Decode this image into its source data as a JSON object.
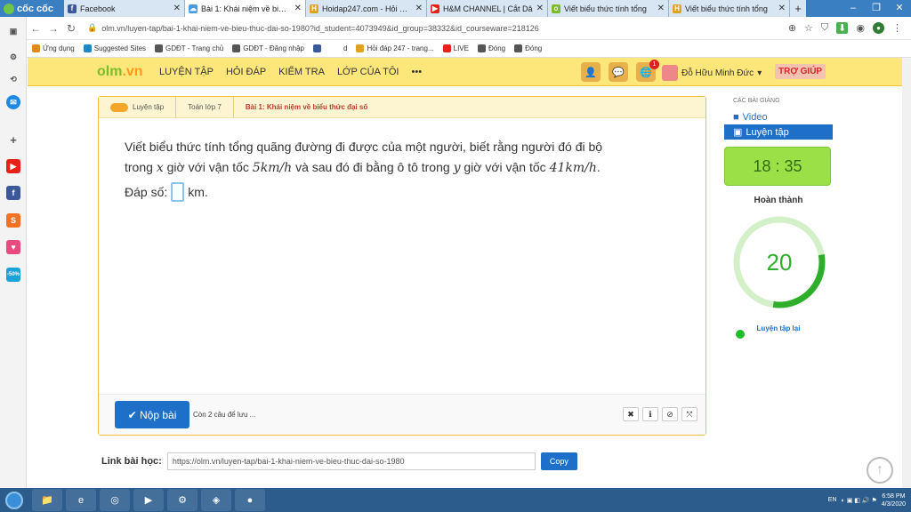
{
  "browser": {
    "brand": "cốc cốc",
    "tabs": [
      {
        "label": "Facebook",
        "icon": "facebook-icon",
        "color": "#3b5998",
        "glyph": "f"
      },
      {
        "label": "Bài 1: Khái niệm về biểu t",
        "icon": "cloud-icon",
        "color": "#4a9be0",
        "glyph": "☁",
        "active": true
      },
      {
        "label": "Hoidap247.com - Hỏi đáp",
        "icon": "hoidap-icon",
        "color": "#e0a020",
        "glyph": "H"
      },
      {
        "label": "H&M CHANNEL | Cắt Dâ",
        "icon": "youtube-icon",
        "color": "#e62117",
        "glyph": "▶"
      },
      {
        "label": "Viết biểu thức tính tổng",
        "icon": "olm-icon",
        "color": "#7cbb2a",
        "glyph": "o"
      },
      {
        "label": "Viết biểu thức tính tổng",
        "icon": "hoidap-icon",
        "color": "#e0a020",
        "glyph": "H"
      }
    ],
    "url": "olm.vn/luyen-tap/bai-1-khai-niem-ve-bieu-thuc-dai-so-1980?id_student=4073949&id_group=38332&id_courseware=218126",
    "bookmarks": [
      {
        "label": "Ứng dụng",
        "color": "#e08a1e"
      },
      {
        "label": "Suggested Sites",
        "color": "#1e88c7"
      },
      {
        "label": "GDĐT - Trang chủ",
        "color": "#555555"
      },
      {
        "label": "GDĐT - Đăng nhập",
        "color": "#555555"
      },
      {
        "label": "",
        "color": "#3b5998"
      },
      {
        "label": "d",
        "color": "#ffffff"
      },
      {
        "label": "Hỏi đáp 247 - trang...",
        "color": "#e0a020"
      },
      {
        "label": "LIVE",
        "color": "#e62117"
      },
      {
        "label": "Đóng",
        "color": "#555555"
      },
      {
        "label": "Đóng",
        "color": "#555555"
      }
    ]
  },
  "olm": {
    "logo_a": "olm",
    "logo_b": ".vn",
    "nav": [
      "LUYỆN TẬP",
      "HỎI ĐÁP",
      "KIỂM TRA",
      "LỚP CỦA TÔI",
      "•••"
    ],
    "notif_count": "1",
    "user_name": "Đỗ Hữu Minh Đức",
    "help": "TRỢ GIÚP"
  },
  "breadcrumb": [
    "Luyện tập",
    "Toán lớp 7",
    "Bài 1: Khái niệm về biểu thức đại số"
  ],
  "question": {
    "line1": "Viết biểu thức tính tổng quãng đường đi được của một người, biết rằng người đó đi bộ",
    "p1": "trong ",
    "var_x": "x",
    "p2": " giờ với vận tốc ",
    "speed1": "5km/h",
    "p3": " và sau đó đi bằng ô tô trong ",
    "var_y": "y",
    "p4": " giờ với vận tốc ",
    "speed2": "41km/h",
    "p5": ".",
    "answer_label": "Đáp số:",
    "unit": "km."
  },
  "footer": {
    "submit": "✔ Nộp bài",
    "remain": "Còn 2 câu để lưu ..."
  },
  "link": {
    "label": "Link bài học:",
    "value": "https://olm.vn/luyen-tap/bai-1-khai-niem-ve-bieu-thuc-dai-so-1980",
    "copy": "Copy"
  },
  "sidebar": {
    "header": "CÁC BÀI GIẢNG",
    "items": [
      {
        "label": "Video",
        "active": false
      },
      {
        "label": "Luyện tập",
        "active": true
      }
    ],
    "timer": "18 : 35",
    "done_label": "Hoàn thành",
    "done_value": "20",
    "progress_fraction": 0.3,
    "retry": "Luyện tập lại"
  },
  "taskbar": {
    "lang": "EN",
    "time": "6:58 PM",
    "date": "4/3/2020"
  }
}
